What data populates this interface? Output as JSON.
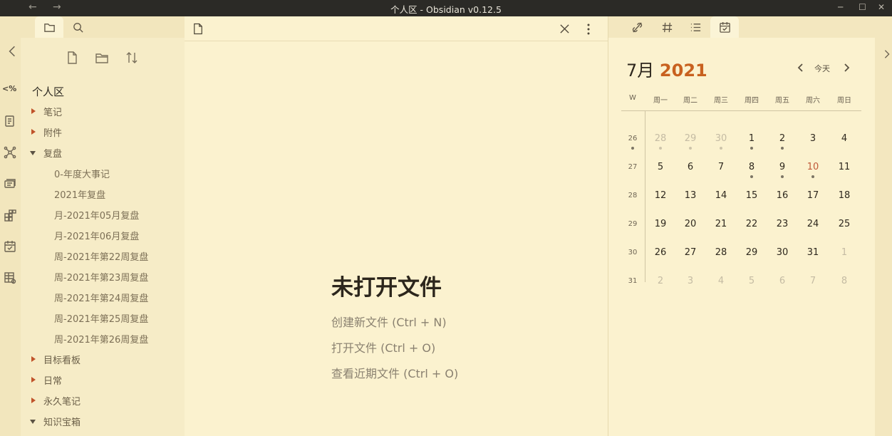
{
  "titlebar": {
    "back": "←",
    "forward": "→",
    "title": "个人区 - Obsidian v0.12.5",
    "minimize": "─",
    "maximize": "☐",
    "close": "✕"
  },
  "ribbon": {
    "collapse_left": "‹",
    "icons": [
      "code-toggle-icon",
      "page-icon",
      "graph-icon",
      "cards-icon",
      "kanban-icon",
      "calendar-icon",
      "table-icon"
    ],
    "code_label": "<%"
  },
  "sidebar": {
    "tabs": [
      "file-explorer-icon",
      "search-icon"
    ],
    "tools": [
      "new-note-icon",
      "new-folder-icon",
      "sort-icon"
    ],
    "vault_name": "个人区",
    "tree": [
      {
        "label": "笔记",
        "type": "folder",
        "expanded": false
      },
      {
        "label": "附件",
        "type": "folder",
        "expanded": false
      },
      {
        "label": "复盘",
        "type": "folder",
        "expanded": true
      },
      {
        "label": "0-年度大事记",
        "type": "file"
      },
      {
        "label": "2021年复盘",
        "type": "file"
      },
      {
        "label": "月-2021年05月复盘",
        "type": "file"
      },
      {
        "label": "月-2021年06月复盘",
        "type": "file"
      },
      {
        "label": "周-2021年第22周复盘",
        "type": "file"
      },
      {
        "label": "周-2021年第23周复盘",
        "type": "file"
      },
      {
        "label": "周-2021年第24周复盘",
        "type": "file"
      },
      {
        "label": "周-2021年第25周复盘",
        "type": "file"
      },
      {
        "label": "周-2021年第26周复盘",
        "type": "file"
      },
      {
        "label": "目标看板",
        "type": "folder",
        "expanded": false
      },
      {
        "label": "日常",
        "type": "folder",
        "expanded": false
      },
      {
        "label": "永久笔记",
        "type": "folder",
        "expanded": false
      },
      {
        "label": "知识宝箱",
        "type": "folder",
        "expanded": true
      }
    ]
  },
  "editor": {
    "empty_title": "未打开文件",
    "actions": [
      "创建新文件 (Ctrl + N)",
      "打开文件 (Ctrl + O)",
      "查看近期文件 (Ctrl + O)"
    ]
  },
  "rightpanel": {
    "tabs": [
      "backlinks-icon",
      "tags-icon",
      "outline-icon",
      "calendar-icon"
    ],
    "calendar": {
      "month": "7月",
      "year": "2021",
      "today_label": "今天",
      "week_header": "W",
      "weekdays": [
        "周一",
        "周二",
        "周三",
        "周四",
        "周五",
        "周六",
        "周日"
      ],
      "weeks": [
        {
          "num": "26",
          "days": [
            {
              "d": "28",
              "dim": true,
              "dot": "light"
            },
            {
              "d": "29",
              "dim": true,
              "dot": "light"
            },
            {
              "d": "30",
              "dim": true,
              "dot": "light"
            },
            {
              "d": "1",
              "dot": "dark"
            },
            {
              "d": "2",
              "dot": "dark"
            },
            {
              "d": "3"
            },
            {
              "d": "4"
            }
          ],
          "wkdot": true
        },
        {
          "num": "27",
          "days": [
            {
              "d": "5"
            },
            {
              "d": "6"
            },
            {
              "d": "7"
            },
            {
              "d": "8",
              "dot": "dark"
            },
            {
              "d": "9",
              "dot": "dark"
            },
            {
              "d": "10",
              "red": true,
              "dot": "dark"
            },
            {
              "d": "11"
            }
          ]
        },
        {
          "num": "28",
          "days": [
            {
              "d": "12"
            },
            {
              "d": "13"
            },
            {
              "d": "14"
            },
            {
              "d": "15"
            },
            {
              "d": "16"
            },
            {
              "d": "17"
            },
            {
              "d": "18"
            }
          ]
        },
        {
          "num": "29",
          "days": [
            {
              "d": "19"
            },
            {
              "d": "20"
            },
            {
              "d": "21"
            },
            {
              "d": "22"
            },
            {
              "d": "23"
            },
            {
              "d": "24"
            },
            {
              "d": "25"
            }
          ]
        },
        {
          "num": "30",
          "days": [
            {
              "d": "26"
            },
            {
              "d": "27"
            },
            {
              "d": "28"
            },
            {
              "d": "29"
            },
            {
              "d": "30"
            },
            {
              "d": "31"
            },
            {
              "d": "1",
              "dim": true
            }
          ]
        },
        {
          "num": "31",
          "days": [
            {
              "d": "2",
              "dim": true
            },
            {
              "d": "3",
              "dim": true
            },
            {
              "d": "4",
              "dim": true
            },
            {
              "d": "5",
              "dim": true
            },
            {
              "d": "6",
              "dim": true
            },
            {
              "d": "7",
              "dim": true
            },
            {
              "d": "8",
              "dim": true
            }
          ]
        }
      ]
    },
    "collapse_right": "›"
  },
  "colors": {
    "accent": "#c8611f",
    "background": "#fbf2cf",
    "titlebar": "#2b2a26"
  }
}
